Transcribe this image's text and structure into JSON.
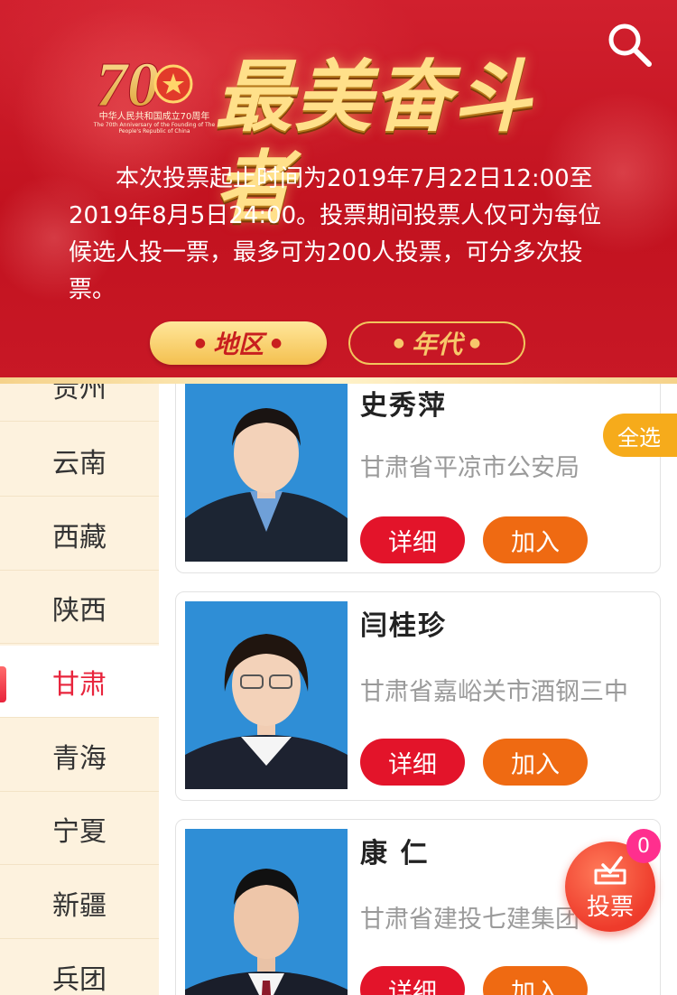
{
  "header": {
    "logo_number": "70",
    "logo_caption_cn": "中华人民共和国成立70周年",
    "logo_caption_en": "The 70th Anniversary of the Founding of The People's Republic of China",
    "title": "最美奋斗者",
    "intro": "本次投票起止时间为2019年7月22日12:00至2019年8月5日24:00。投票期间投票人仅可为每位候选人投一票，最多可为200人投票，可分多次投票。",
    "filters": [
      {
        "label": "地区",
        "active": true
      },
      {
        "label": "年代",
        "active": false
      }
    ]
  },
  "sidebar": {
    "items": [
      {
        "label": "贵州",
        "active": false
      },
      {
        "label": "云南",
        "active": false
      },
      {
        "label": "西藏",
        "active": false
      },
      {
        "label": "陕西",
        "active": false
      },
      {
        "label": "甘肃",
        "active": true
      },
      {
        "label": "青海",
        "active": false
      },
      {
        "label": "宁夏",
        "active": false
      },
      {
        "label": "新疆",
        "active": false
      },
      {
        "label": "兵团",
        "active": false
      }
    ]
  },
  "candidates": [
    {
      "name": "史秀萍",
      "org": "甘肃省平凉市公安局",
      "detail_label": "详细",
      "join_label": "加入"
    },
    {
      "name": "闫桂珍",
      "org": "甘肃省嘉峪关市酒钢三中",
      "detail_label": "详细",
      "join_label": "加入"
    },
    {
      "name": "康 仁",
      "org": "甘肃省建投七建集团",
      "detail_label": "详细",
      "join_label": "加入"
    }
  ],
  "select_all_label": "全选",
  "vote": {
    "label": "投票",
    "count": "0"
  },
  "colors": {
    "accent_red": "#e3142a",
    "join_orange": "#ef6a12",
    "gold": "#f4c04f",
    "badge_pink": "#ff2f8e"
  }
}
